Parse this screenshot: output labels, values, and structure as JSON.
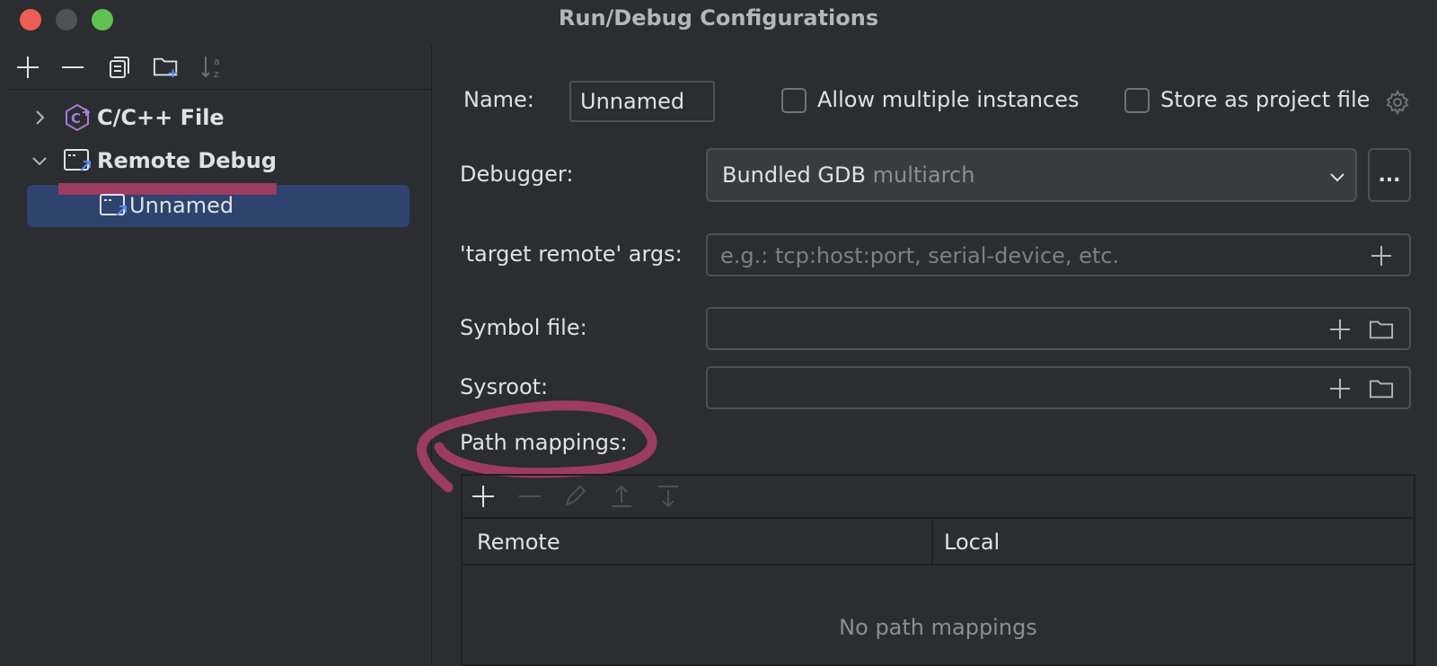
{
  "window": {
    "title": "Run/Debug Configurations"
  },
  "tree": {
    "items": [
      {
        "label": "C/C++ File"
      },
      {
        "label": "Remote Debug"
      },
      {
        "label": "Unnamed"
      }
    ]
  },
  "form": {
    "name_label": "Name:",
    "name_value": "Unnamed",
    "allow_multiple_label": "Allow multiple instances",
    "store_project_label": "Store as project file",
    "debugger_label": "Debugger:",
    "debugger_value": "Bundled GDB",
    "debugger_hint": "multiarch",
    "debugger_more": "...",
    "target_remote_label": "'target remote' args:",
    "target_remote_placeholder": "e.g.: tcp:host:port, serial-device, etc.",
    "symbol_file_label": "Symbol file:",
    "sysroot_label": "Sysroot:",
    "path_mappings_label": "Path mappings:"
  },
  "path_mappings": {
    "columns": [
      "Remote",
      "Local"
    ],
    "empty_text": "No path mappings"
  },
  "colors": {
    "selection": "#2e436e",
    "annotation": "#9c3c5e",
    "config_icon_accent": "#a77bd8",
    "remote_icon_accent": "#548af7"
  }
}
